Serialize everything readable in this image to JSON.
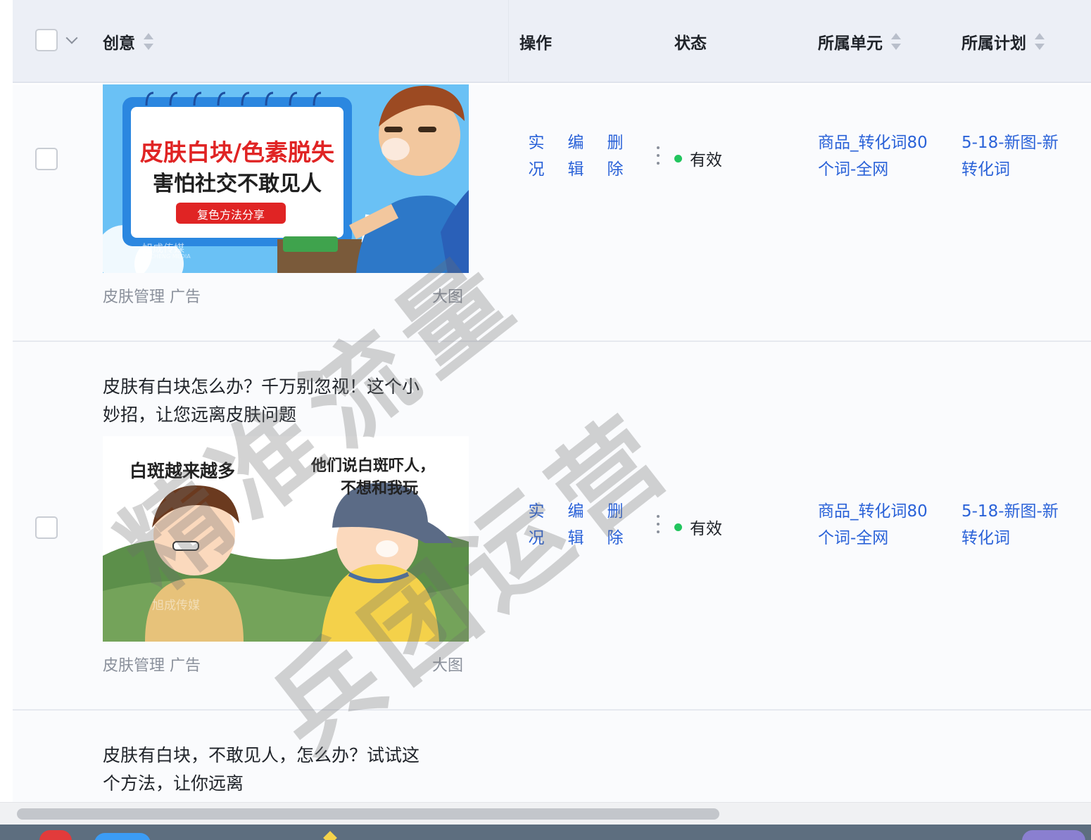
{
  "header": {
    "creative": "创意",
    "operation": "操作",
    "status": "状态",
    "unit": "所属单元",
    "plan": "所属计划"
  },
  "rows": [
    {
      "title": "",
      "image": {
        "headline": "皮肤白块/色素脱失",
        "subline": "害怕社交不敢见人",
        "button": "复色方法分享",
        "brand": "旭成传媒",
        "brand_en": "XUCHENG MEDIA"
      },
      "tag": "皮肤管理 广告",
      "size": "大图",
      "ops": [
        {
          "a": "实",
          "b": "况"
        },
        {
          "a": "编",
          "b": "辑"
        },
        {
          "a": "删",
          "b": "除"
        }
      ],
      "status": "有效",
      "unit": [
        "商品_转化词80",
        "个词-全网"
      ],
      "plan": [
        "5-18-新图-新",
        "转化词"
      ]
    },
    {
      "title": [
        "皮肤有白块怎么办？千万别忽视！这个小",
        "妙招，让您远离皮肤问题"
      ],
      "image": {
        "left_caption": "白斑越来越多",
        "right_caption_1": "他们说白斑吓人，",
        "right_caption_2": "不想和我玩",
        "brand": "旭成传媒"
      },
      "tag": "皮肤管理 广告",
      "size": "大图",
      "ops": [
        {
          "a": "实",
          "b": "况"
        },
        {
          "a": "编",
          "b": "辑"
        },
        {
          "a": "删",
          "b": "除"
        }
      ],
      "status": "有效",
      "unit": [
        "商品_转化词80",
        "个词-全网"
      ],
      "plan": [
        "5-18-新图-新",
        "转化词"
      ]
    },
    {
      "title": [
        "皮肤有白块，不敢见人，怎么办？试试这",
        "个方法，让你远离"
      ]
    }
  ],
  "watermark": {
    "line1": "精准流量",
    "line2": "兵团运营"
  },
  "colors": {
    "header_bg": "#eceff6",
    "link": "#2a62d8",
    "status_dot": "#22c55e"
  }
}
